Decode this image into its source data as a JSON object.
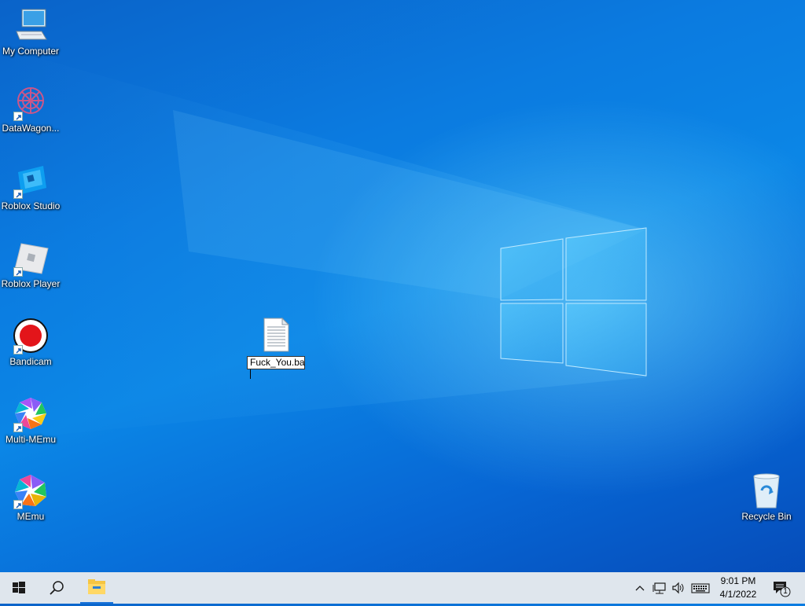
{
  "desktop": {
    "icons": [
      {
        "label": "My Computer",
        "icon": "computer-icon",
        "shortcut": false
      },
      {
        "label": "DataWagon...",
        "icon": "datawagon-icon",
        "shortcut": true
      },
      {
        "label": "Roblox Studio",
        "icon": "roblox-studio-icon",
        "shortcut": true
      },
      {
        "label": "Roblox Player",
        "icon": "roblox-player-icon",
        "shortcut": true
      },
      {
        "label": "Bandicam",
        "icon": "bandicam-icon",
        "shortcut": true
      },
      {
        "label": "Multi-MEmu",
        "icon": "multi-memu-icon",
        "shortcut": true
      },
      {
        "label": "MEmu",
        "icon": "memu-icon",
        "shortcut": true
      }
    ],
    "recycle_bin": {
      "label": "Recycle Bin",
      "icon": "recycle-bin-icon"
    },
    "renaming_file": {
      "value": "Fuck_You.ba",
      "icon": "text-file-icon"
    }
  },
  "taskbar": {
    "start": {
      "icon": "windows-start-icon"
    },
    "search": {
      "icon": "search-icon"
    },
    "pinned": [
      {
        "icon": "file-explorer-icon",
        "active": true
      }
    ],
    "tray": {
      "icons": [
        "chevron-up-icon",
        "network-icon",
        "volume-icon",
        "keyboard-icon"
      ],
      "time": "9:01 PM",
      "date": "4/1/2022",
      "notifications": {
        "icon": "action-center-icon",
        "count": "1"
      }
    }
  },
  "colors": {
    "wallpaper_dark": "#0548b5",
    "wallpaper_light": "#0b86e6",
    "taskbar": "#dfe6ed",
    "accent": "#1a73d9"
  }
}
